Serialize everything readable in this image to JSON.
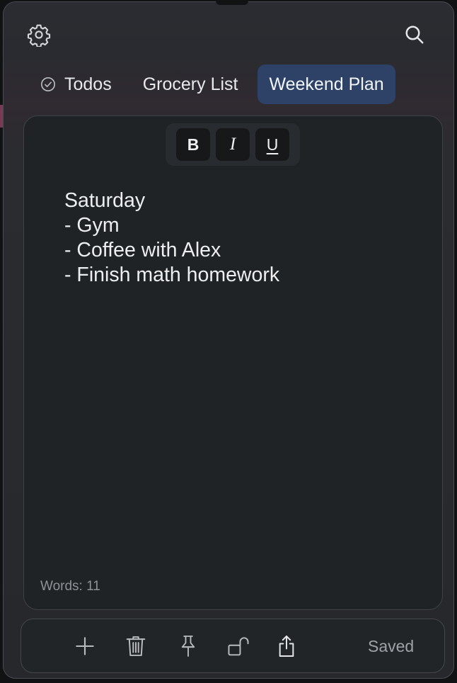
{
  "header": {
    "settings_icon": "gear-icon",
    "search_icon": "search-icon"
  },
  "tabs": [
    {
      "label": "Todos",
      "icon": "check-circle-icon",
      "active": false
    },
    {
      "label": "Grocery List",
      "active": false
    },
    {
      "label": "Weekend Plan",
      "active": true
    }
  ],
  "format_toolbar": {
    "bold_label": "B",
    "italic_label": "I",
    "underline_label": "U"
  },
  "note": {
    "lines": [
      "Saturday",
      "- Gym",
      "- Coffee with Alex",
      "- Finish math homework"
    ]
  },
  "status": {
    "word_count": "Words: 11",
    "saved": "Saved"
  },
  "bottom_toolbar": {
    "icons": [
      "plus-icon",
      "trash-icon",
      "pin-icon",
      "unlock-icon",
      "share-icon"
    ]
  },
  "colors": {
    "active_tab": "#2d4266",
    "editor_bg": "#202326",
    "text": "#eceef0"
  }
}
